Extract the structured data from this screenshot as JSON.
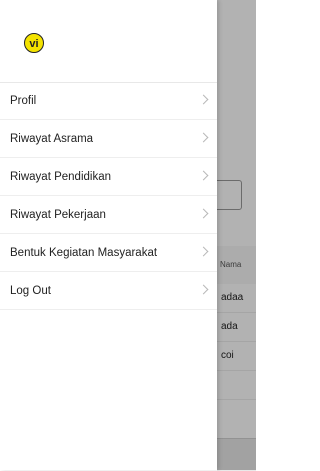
{
  "logo": {
    "text": "vi",
    "colors": {
      "fill": "#f4e300",
      "outline": "#222222"
    }
  },
  "menu": {
    "items": [
      {
        "label": "Profil"
      },
      {
        "label": "Riwayat Asrama"
      },
      {
        "label": "Riwayat Pendidikan"
      },
      {
        "label": "Riwayat Pekerjaan"
      },
      {
        "label": "Bentuk Kegiatan Masyarakat"
      },
      {
        "label": "Log Out"
      }
    ]
  },
  "background": {
    "table": {
      "header": "Nama",
      "rows": [
        "adaa",
        "ada",
        "coi"
      ]
    }
  }
}
